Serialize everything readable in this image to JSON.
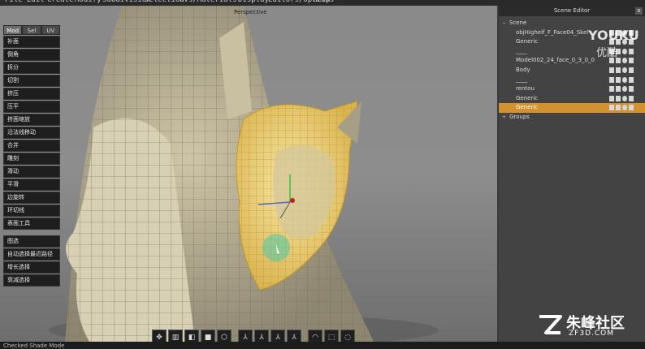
{
  "menubar": [
    "File",
    "Edit",
    "Create",
    "Modify",
    "Subdivision",
    "Selection",
    "UVs/Materials",
    "Display",
    "Editors/Options",
    "Help"
  ],
  "viewport": {
    "label": "Perspective"
  },
  "tool_tabs": [
    {
      "label": "Mod",
      "active": true
    },
    {
      "label": "Sel",
      "active": false
    },
    {
      "label": "UV",
      "active": false
    }
  ],
  "tools_group1": [
    "补面",
    "倒角",
    "拆分",
    "切割",
    "挤压",
    "压平",
    "挤面缩放",
    "沿法线移动",
    "合并",
    "雕刻",
    "滑动",
    "平滑",
    "边旋转",
    "环切线",
    "表面工具"
  ],
  "tools_group2": [
    "图选",
    "自动选择最近路径",
    "增长选择",
    "衰减选择"
  ],
  "status": "Checked Shade Mode",
  "scene_editor": {
    "title": "Scene Editor",
    "close": "x",
    "rows": [
      {
        "label": "Scene",
        "indent": 0,
        "expander": "−",
        "icons": false,
        "selected": false
      },
      {
        "label": "objHighelf_F_Face04_Skel",
        "indent": 1,
        "expander": "",
        "icons": true,
        "selected": false
      },
      {
        "label": "Generic",
        "indent": 2,
        "expander": "",
        "icons": true,
        "selected": false
      },
      {
        "label": "____",
        "indent": 1,
        "expander": "",
        "icons": true,
        "selected": false
      },
      {
        "label": "Model002_24_face_0_3_0_0",
        "indent": 1,
        "expander": "",
        "icons": true,
        "selected": false
      },
      {
        "label": "Body",
        "indent": 2,
        "expander": "",
        "icons": true,
        "selected": false
      },
      {
        "label": "____",
        "indent": 1,
        "expander": "",
        "icons": true,
        "selected": false
      },
      {
        "label": "rentou",
        "indent": 1,
        "expander": "",
        "icons": true,
        "selected": false
      },
      {
        "label": "Generic",
        "indent": 2,
        "expander": "",
        "icons": true,
        "selected": false
      },
      {
        "label": "Generic",
        "indent": 2,
        "expander": "",
        "icons": true,
        "selected": true
      },
      {
        "label": "Groups",
        "indent": 0,
        "expander": "+",
        "icons": false,
        "selected": false
      }
    ]
  },
  "watermark": {
    "youku": "YOUKU",
    "youku_cn": "优酷",
    "zf_cn": "朱峰社区",
    "zf_en": "ZF3D.COM"
  }
}
